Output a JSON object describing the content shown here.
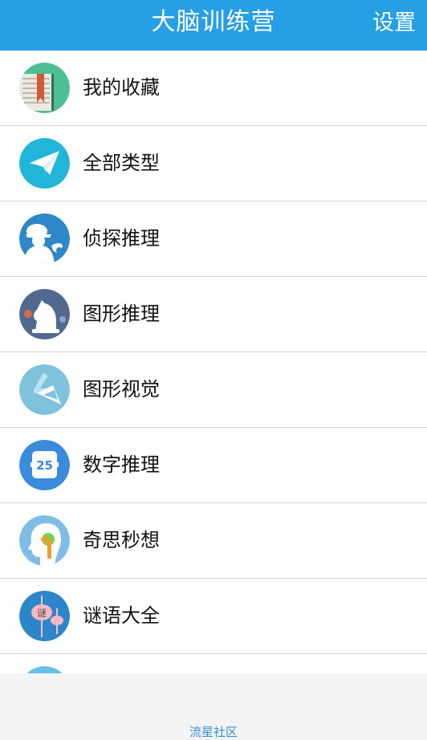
{
  "header": {
    "title": "大脑训练营",
    "settings_label": "设置"
  },
  "colors": {
    "header_bg": "#279fe6",
    "footer_link": "#3b8fd8"
  },
  "menu": {
    "items": [
      {
        "label": "我的收藏",
        "icon": "book-icon"
      },
      {
        "label": "全部类型",
        "icon": "paper-plane-icon"
      },
      {
        "label": "侦探推理",
        "icon": "detective-icon"
      },
      {
        "label": "图形推理",
        "icon": "chess-knight-icon"
      },
      {
        "label": "图形视觉",
        "icon": "shapes-icon"
      },
      {
        "label": "数字推理",
        "icon": "calendar-number-icon"
      },
      {
        "label": "奇思秒想",
        "icon": "head-idea-icon"
      },
      {
        "label": "谜语大全",
        "icon": "lantern-riddle-icon"
      }
    ],
    "calendar_icon_text": "25",
    "lantern_text": "谜"
  },
  "footer": {
    "brand": "流星社区"
  }
}
